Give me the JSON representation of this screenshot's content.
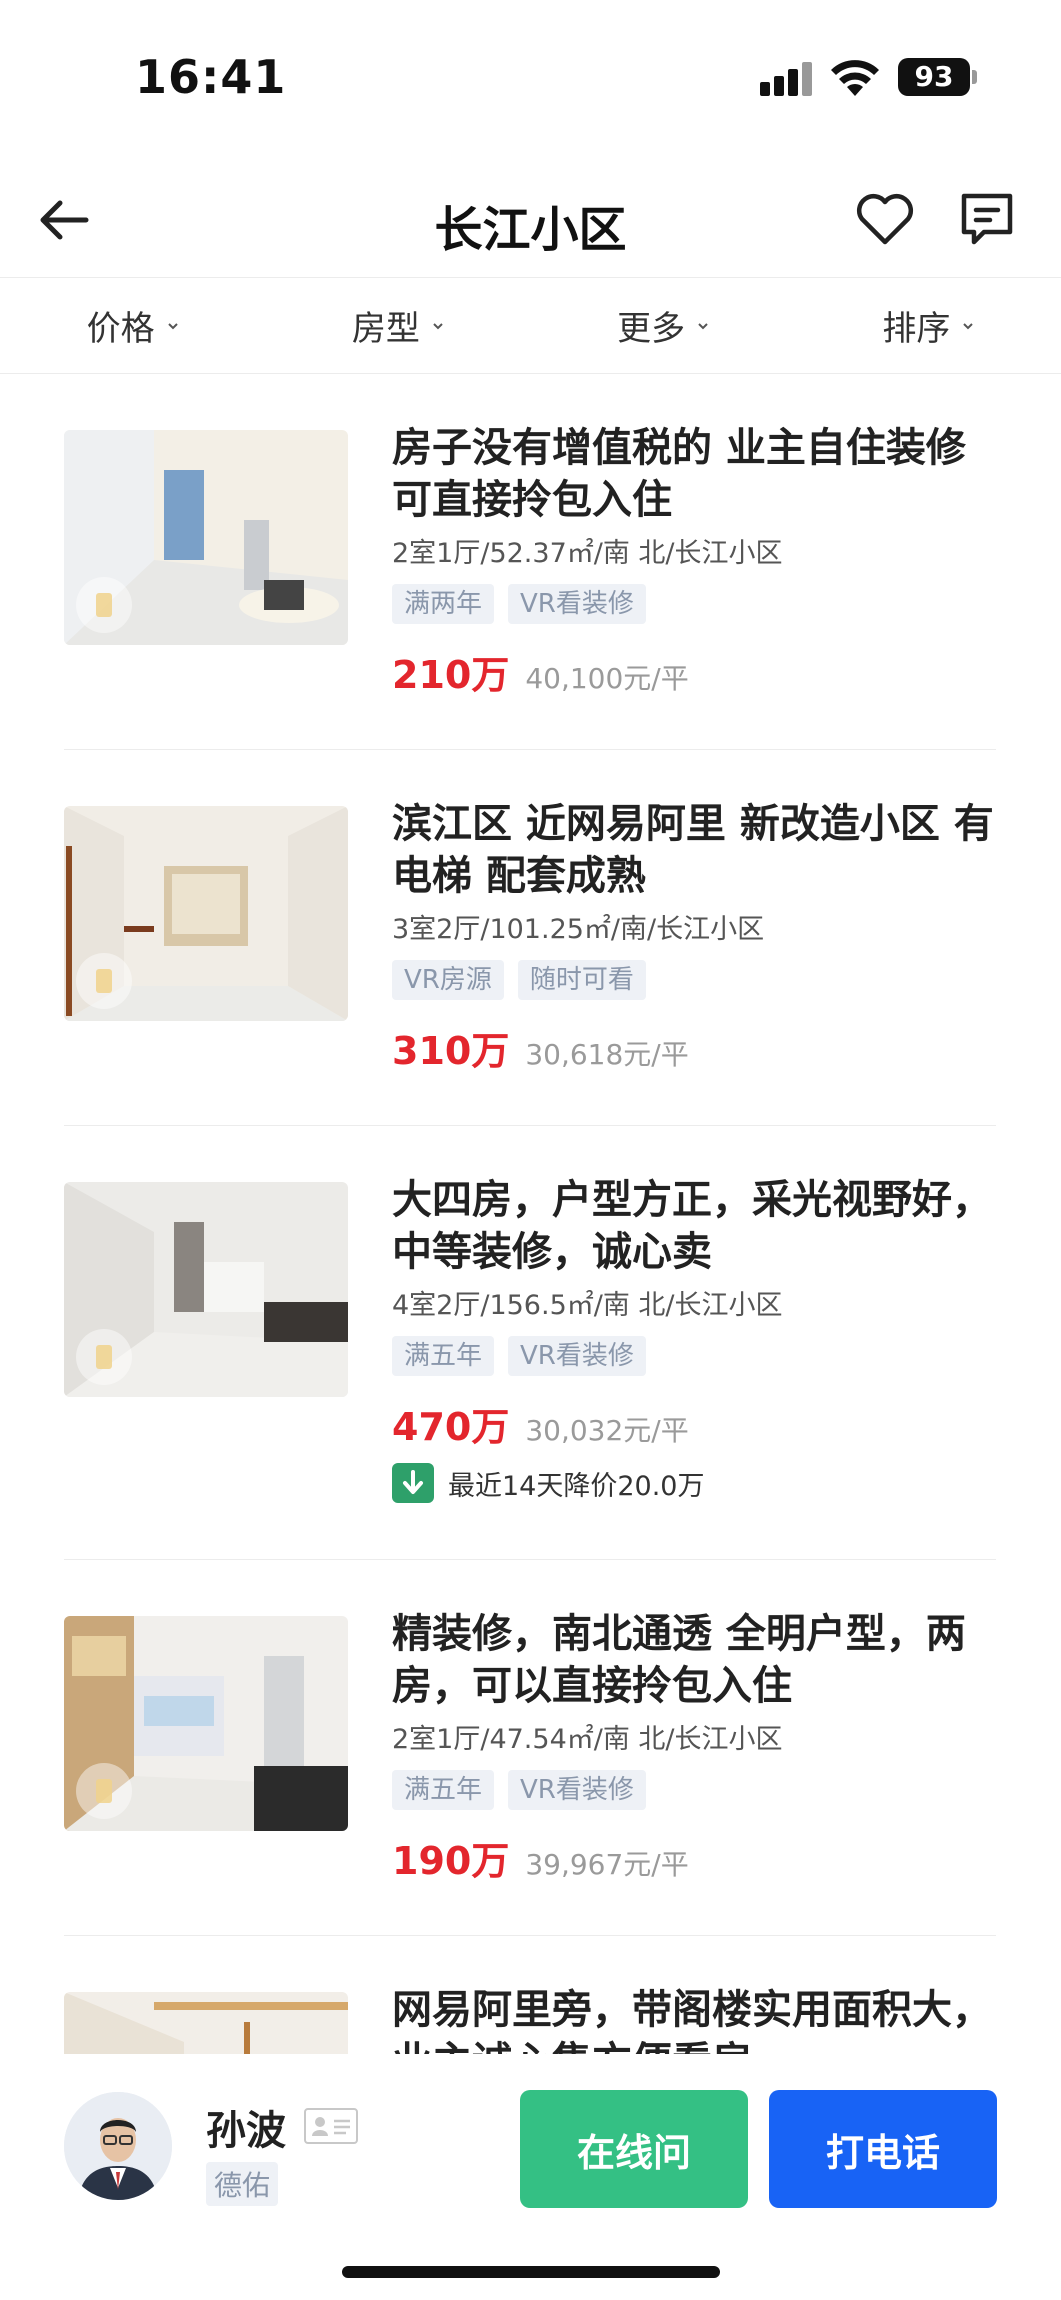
{
  "status_bar": {
    "time": "16:41",
    "battery": "93"
  },
  "header": {
    "title": "长江小区"
  },
  "filters": [
    {
      "label": "价格"
    },
    {
      "label": "房型"
    },
    {
      "label": "更多"
    },
    {
      "label": "排序"
    }
  ],
  "listings": [
    {
      "title": "房子没有增值税的 业主自住装修 可直接拎包入住",
      "meta": "2室1厅/52.37㎡/南 北/长江小区",
      "tags": [
        "满两年",
        "VR看装修"
      ],
      "price": "210万",
      "unit_price": "40,100元/平"
    },
    {
      "title": "滨江区 近网易阿里 新改造小区 有电梯 配套成熟",
      "meta": "3室2厅/101.25㎡/南/长江小区",
      "tags": [
        "VR房源",
        "随时可看"
      ],
      "price": "310万",
      "unit_price": "30,618元/平"
    },
    {
      "title": "大四房，户型方正，采光视野好，中等装修，诚心卖",
      "meta": "4室2厅/156.5㎡/南 北/长江小区",
      "tags": [
        "满五年",
        "VR看装修"
      ],
      "price": "470万",
      "unit_price": "30,032元/平",
      "price_drop": "最近14天降价20.0万"
    },
    {
      "title": "精装修，南北通透 全明户型，两房，可以直接拎包入住",
      "meta": "2室1厅/47.54㎡/南 北/长江小区",
      "tags": [
        "满五年",
        "VR看装修"
      ],
      "price": "190万",
      "unit_price": "39,967元/平"
    },
    {
      "title": "网易阿里旁，带阁楼实用面积大，业主诚心售方便看房"
    }
  ],
  "agent": {
    "name": "孙波",
    "company": "德佑",
    "chat_label": "在线问",
    "call_label": "打电话"
  },
  "colors": {
    "price": "#e3262d",
    "chat_button": "#34c084",
    "call_button": "#1863f5",
    "tag_text": "#8a97ab",
    "tag_bg": "#eef1f6"
  }
}
